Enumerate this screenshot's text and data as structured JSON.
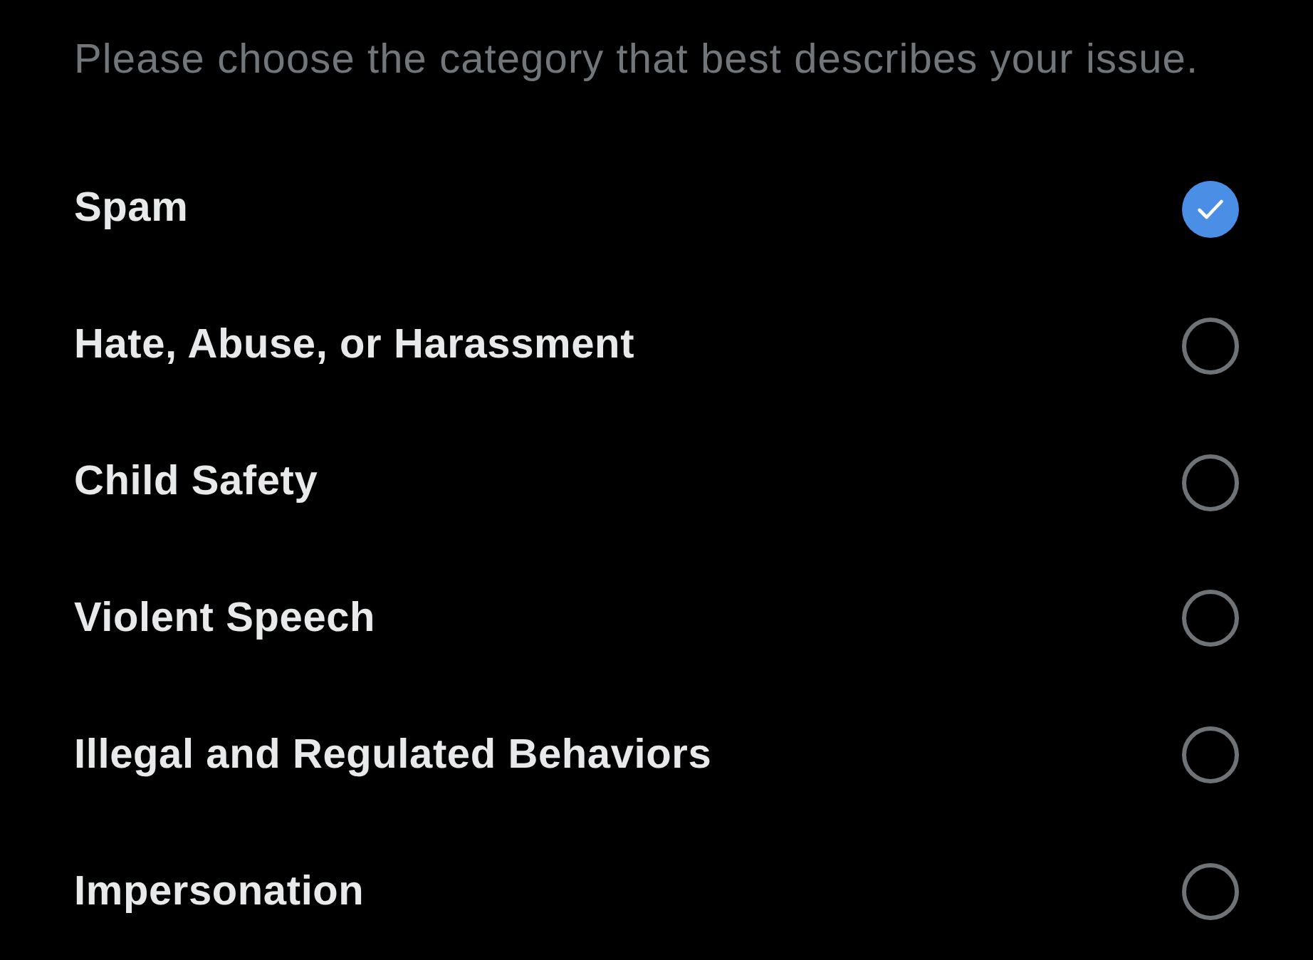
{
  "prompt": "Please choose the category that best describes your issue.",
  "categories": [
    {
      "label": "Spam",
      "selected": true
    },
    {
      "label": "Hate, Abuse, or Harassment",
      "selected": false
    },
    {
      "label": "Child Safety",
      "selected": false
    },
    {
      "label": "Violent Speech",
      "selected": false
    },
    {
      "label": "Illegal and Regulated Behaviors",
      "selected": false
    },
    {
      "label": "Impersonation",
      "selected": false
    }
  ]
}
